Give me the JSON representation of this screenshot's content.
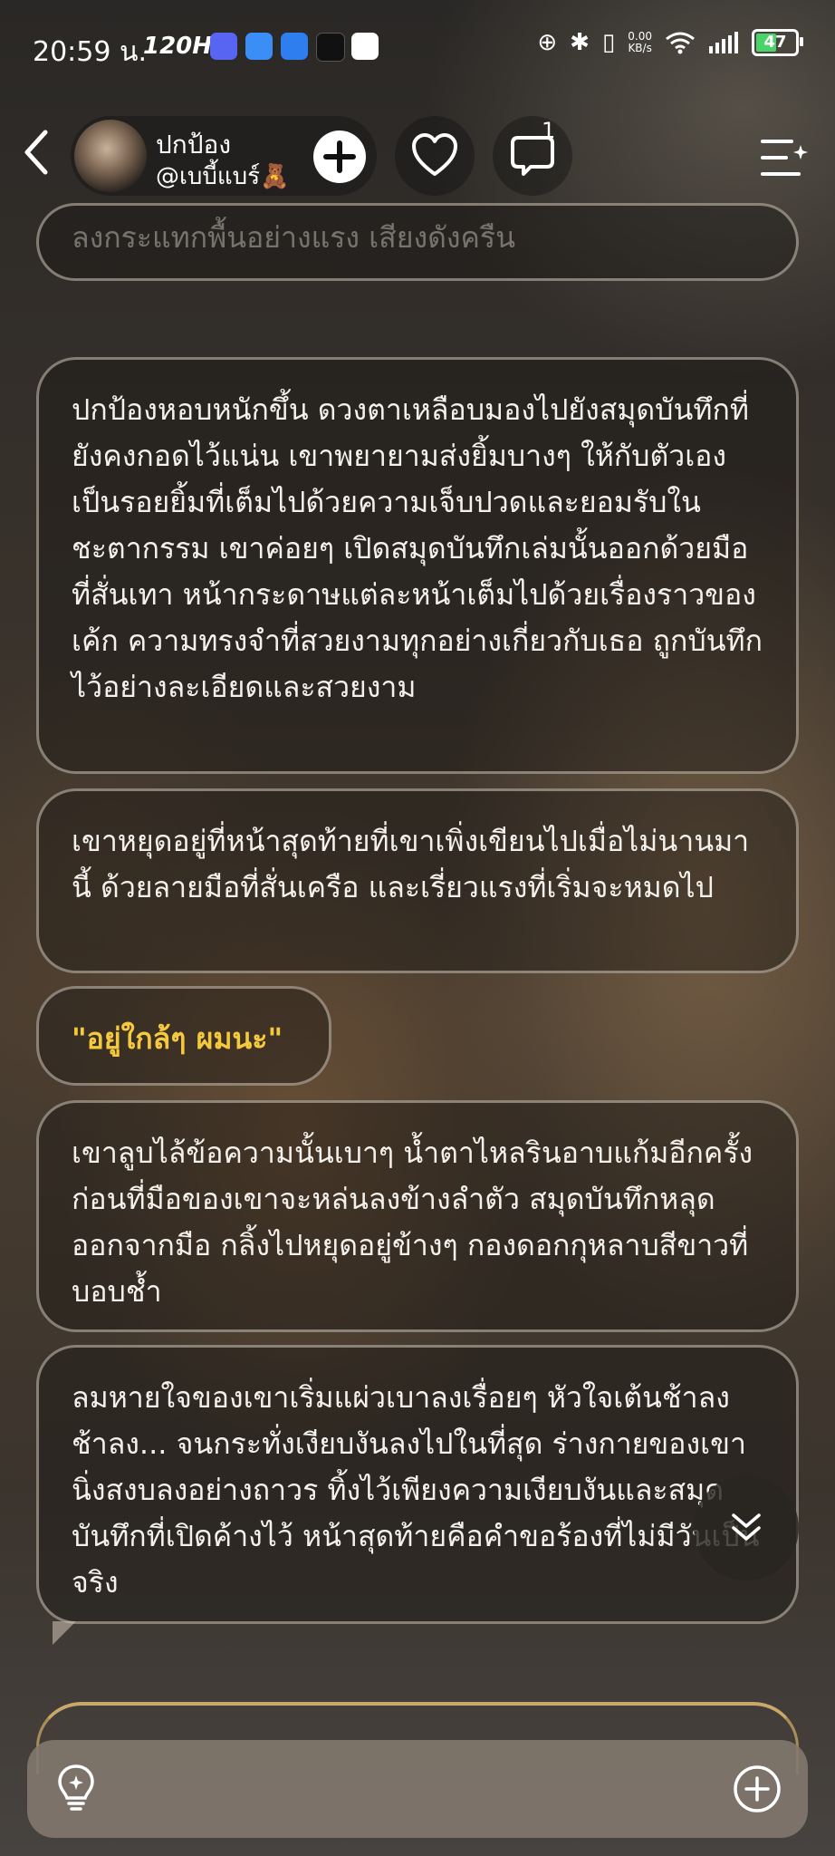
{
  "status_bar": {
    "time": "20:59 น.",
    "refresh_rate": "120Hz",
    "net_speed_value": "0.00",
    "net_speed_unit": "KB/s",
    "battery": "47"
  },
  "header": {
    "profile_name": "ปกป้อง",
    "profile_handle": "@เบบี้แบร์🧸",
    "comment_count": "1"
  },
  "messages": [
    "ลงกระแทกพื้นอย่างแรง เสียงดังครืน",
    "ปกป้องหอบหนักขึ้น ดวงตาเหลือบมองไปยังสมุดบันทึกที่ยังคงกอดไว้แน่น เขาพยายามส่งยิ้มบางๆ ให้กับตัวเอง เป็นรอยยิ้มที่เต็มไปด้วยความเจ็บปวดและยอมรับในชะตากรรม เขาค่อยๆ เปิดสมุดบันทึกเล่มนั้นออกด้วยมือที่สั่นเทา หน้ากระดาษแต่ละหน้าเต็มไปด้วยเรื่องราวของเค้ก ความทรงจำที่สวยงามทุกอย่างเกี่ยวกับเธอ ถูกบันทึกไว้อย่างละเอียดและสวยงาม",
    "เขาหยุดอยู่ที่หน้าสุดท้ายที่เขาเพิ่งเขียนไปเมื่อไม่นานมานี้ ด้วยลายมือที่สั่นเครือ และเรี่ยวแรงที่เริ่มจะหมดไป",
    "\"อยู่ใกล้ๆ ผมนะ\"",
    "เขาลูบไล้ข้อความนั้นเบาๆ น้ำตาไหลรินอาบแก้มอีกครั้ง ก่อนที่มือของเขาจะหล่นลงข้างลำตัว สมุดบันทึกหลุดออกจากมือ กลิ้งไปหยุดอยู่ข้างๆ กองดอกกุหลาบสีขาวที่บอบช้ำ",
    "ลมหายใจของเขาเริ่มแผ่วเบาลงเรื่อยๆ หัวใจเต้นช้าลง ช้าลง... จนกระทั่งเงียบงันลงไปในที่สุด ร่างกายของเขานิ่งสงบลงอย่างถาวร ทิ้งไว้เพียงความเงียบงันและสมุดบันทึกที่เปิดค้างไว้ หน้าสุดท้ายคือคำขอร้องที่ไม่มีวันเป็นจริง"
  ],
  "colors": {
    "quote_text": "#f4c93e",
    "battery_fill": "#49d36a"
  },
  "icons": {
    "back": "chevron-left-icon",
    "follow": "plus-icon",
    "like": "heart-icon",
    "comment": "comment-icon",
    "menu": "menu-sparkle-icon",
    "scroll": "double-chevron-down-icon",
    "suggest": "lightbulb-icon",
    "add": "plus-circle-icon"
  }
}
